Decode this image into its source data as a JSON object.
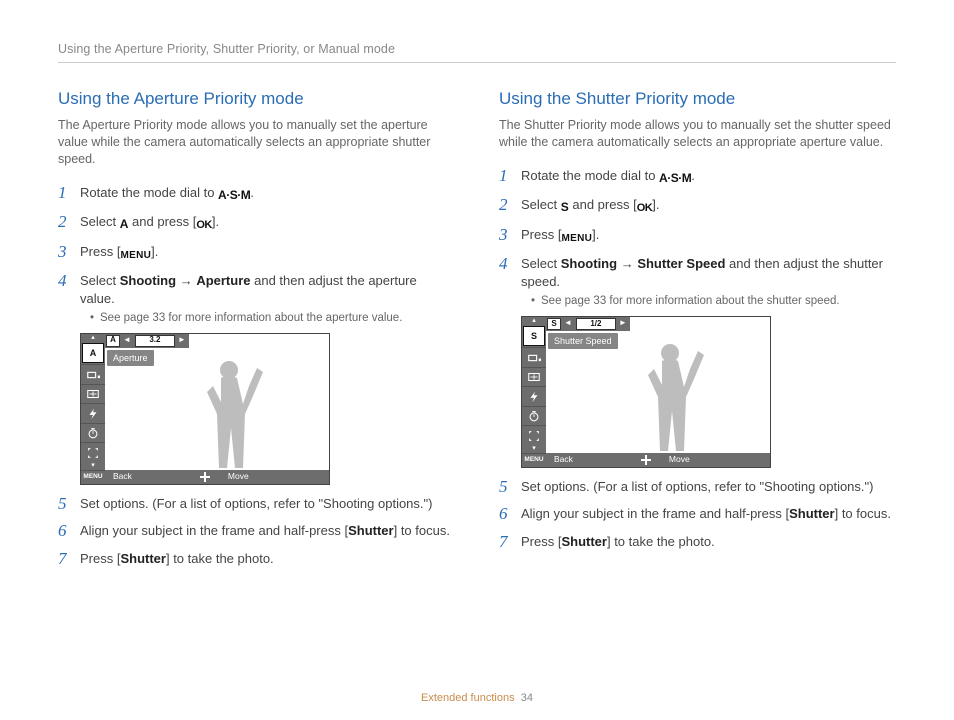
{
  "breadcrumb": "Using the Aperture Priority, Shutter Priority, or Manual mode",
  "footer": {
    "section": "Extended functions",
    "page": "34"
  },
  "icons": {
    "asm": "A·S·M",
    "ok": "OK",
    "menu": "MENU",
    "mode_a": "A",
    "mode_s": "S"
  },
  "left": {
    "title": "Using the Aperture Priority mode",
    "intro": "The Aperture Priority mode allows you to manually set the aperture value while the camera automatically selects an appropriate shutter speed.",
    "steps": {
      "s1_a": "Rotate the mode dial to ",
      "s1_c": ".",
      "s2_a": "Select ",
      "s2_c": " and press [",
      "s2_e": "].",
      "s3_a": "Press [",
      "s3_c": "].",
      "s4_a": "Select ",
      "s4_b": "Shooting",
      "s4_c": " → ",
      "s4_d": "Aperture",
      "s4_e": " and then adjust the aperture value.",
      "s4_bullet": "See page 33 for more information about the aperture value.",
      "s5": "Set options. (For a list of options, refer to \"Shooting options.\")",
      "s6_a": "Align your subject in the frame and half-press [",
      "s6_b": "Shutter",
      "s6_c": "] to focus.",
      "s7_a": "Press [",
      "s7_b": "Shutter",
      "s7_c": "] to take the photo."
    },
    "lcd": {
      "mode_letter": "A",
      "value": "3.2",
      "label": "Aperture",
      "back": "Back",
      "move": "Move"
    }
  },
  "right": {
    "title": "Using the Shutter Priority mode",
    "intro": "The Shutter Priority mode allows you to manually set the shutter speed while the camera automatically selects an appropriate aperture value.",
    "steps": {
      "s1_a": "Rotate the mode dial to ",
      "s1_c": ".",
      "s2_a": "Select ",
      "s2_c": " and press [",
      "s2_e": "].",
      "s3_a": "Press [",
      "s3_c": "].",
      "s4_a": "Select ",
      "s4_b": "Shooting",
      "s4_c": " → ",
      "s4_d": "Shutter Speed",
      "s4_e": " and then adjust the shutter speed.",
      "s4_bullet": "See page 33 for more information about the shutter speed.",
      "s5": "Set options. (For a list of options, refer to \"Shooting options.\")",
      "s6_a": "Align your subject in the frame and half-press [",
      "s6_b": "Shutter",
      "s6_c": "] to focus.",
      "s7_a": "Press [",
      "s7_b": "Shutter",
      "s7_c": "] to take the photo."
    },
    "lcd": {
      "mode_letter": "S",
      "value": "1/2",
      "label": "Shutter Speed",
      "back": "Back",
      "move": "Move"
    }
  }
}
